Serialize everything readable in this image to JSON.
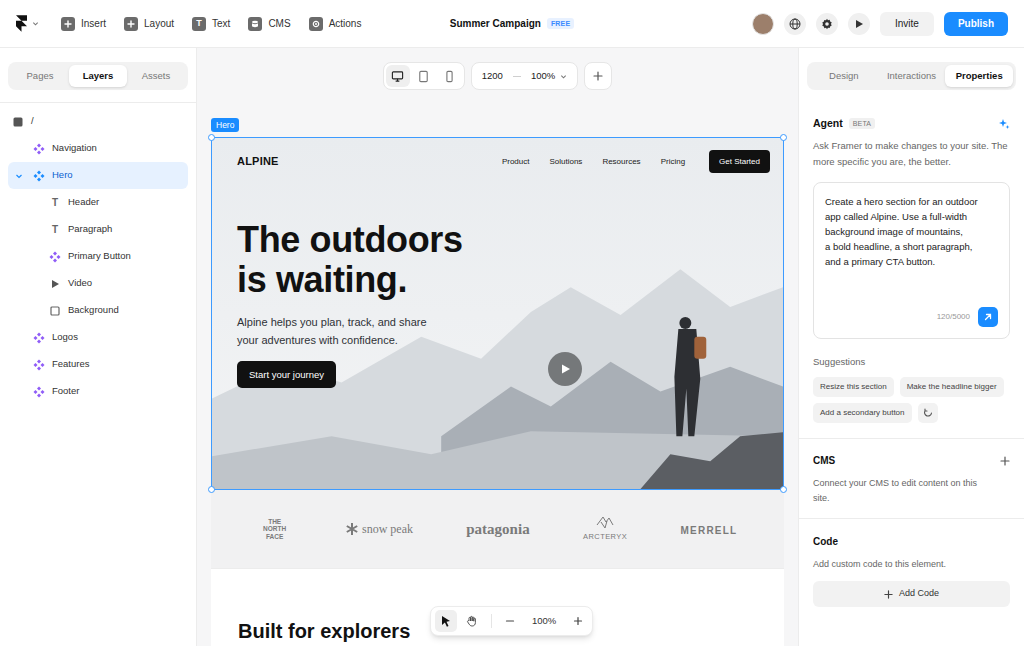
{
  "topbar": {
    "menu": [
      {
        "label": "Insert",
        "kind": "insert"
      },
      {
        "label": "Layout",
        "kind": "layout"
      },
      {
        "label": "Text",
        "kind": "text",
        "icon": "T"
      },
      {
        "label": "CMS",
        "kind": "cms"
      },
      {
        "label": "Actions",
        "kind": "actions"
      }
    ],
    "project": {
      "title": "Summer Campaign",
      "badge": "FREE"
    },
    "invite": "Invite",
    "publish": "Publish"
  },
  "left_panel": {
    "tabs": [
      {
        "label": "Pages",
        "selected": false
      },
      {
        "label": "Layers",
        "selected": true
      },
      {
        "label": "Assets",
        "selected": false
      }
    ],
    "layers": [
      {
        "label": "/",
        "kind": "page",
        "selected": false
      },
      {
        "label": "Navigation",
        "kind": "component",
        "selected": false
      },
      {
        "label": "Hero",
        "kind": "component",
        "selected": true,
        "expanded": true,
        "children": [
          {
            "label": "Header",
            "kind": "text",
            "icon": "T",
            "selected": false
          },
          {
            "label": "Paragraph",
            "kind": "text",
            "icon": "T",
            "selected": false
          },
          {
            "label": "Primary Button",
            "kind": "component",
            "selected": false
          },
          {
            "label": "Video",
            "kind": "video",
            "selected": false
          },
          {
            "label": "Background",
            "kind": "rectangle",
            "selected": false
          }
        ]
      },
      {
        "label": "Logos",
        "kind": "component",
        "selected": false
      },
      {
        "label": "Features",
        "kind": "component",
        "selected": false
      },
      {
        "label": "Footer",
        "kind": "component",
        "selected": false
      }
    ]
  },
  "canvas": {
    "devices": [
      {
        "kind": "desktop",
        "selected": true
      },
      {
        "kind": "tablet",
        "selected": false
      },
      {
        "kind": "phone",
        "selected": false
      }
    ],
    "width": "1200",
    "zoom": "100%",
    "selection_label": "Hero",
    "site": {
      "brand": "ALPINE",
      "nav": [
        "Product",
        "Solutions",
        "Resources",
        "Pricing"
      ],
      "nav_button": "Get Started",
      "headline": [
        "The outdoors",
        "is waiting."
      ],
      "paragraph": [
        "Alpine helps you plan, track, and share",
        "your adventures with confidence."
      ],
      "cta": "Start your journey",
      "logos": [
        {
          "text": "THE NORTH FACE",
          "kind": "stacked"
        },
        {
          "text": "snow peak",
          "kind": "icon-left"
        },
        {
          "text": "patagonia",
          "kind": "serif"
        },
        {
          "text": "ARCTERYX",
          "kind": "icon-above"
        },
        {
          "text": "MERRELL",
          "kind": "caps"
        }
      ],
      "section_heading": "Built for explorers"
    },
    "bottom_toolbar": {
      "tools": [
        {
          "kind": "select",
          "selected": true
        },
        {
          "kind": "hand",
          "selected": false
        }
      ],
      "zoom": "100%"
    }
  },
  "right_panel": {
    "tabs": [
      {
        "label": "Design",
        "selected": false
      },
      {
        "label": "Interactions",
        "selected": false
      },
      {
        "label": "Properties",
        "selected": true
      }
    ],
    "agent": {
      "title": "Agent",
      "badge": "BETA",
      "description": "Ask Framer to make changes to your site. The more specific you are, the better.",
      "prompt": [
        "Create a hero section for an outdoor",
        "app called Alpine. Use a full-width",
        "background image of mountains,",
        "a bold headline, a short paragraph,",
        "and a primary CTA button."
      ],
      "count": "120/5000"
    },
    "suggestions": {
      "title": "Suggestions",
      "items": [
        "Resize this section",
        "Make the headline bigger",
        "Add a secondary button"
      ]
    },
    "cms": {
      "title": "CMS",
      "text": "Connect your CMS to edit content on this site."
    },
    "code": {
      "title": "Code",
      "text": "Add custom code to this element.",
      "button": "Add Code"
    }
  }
}
